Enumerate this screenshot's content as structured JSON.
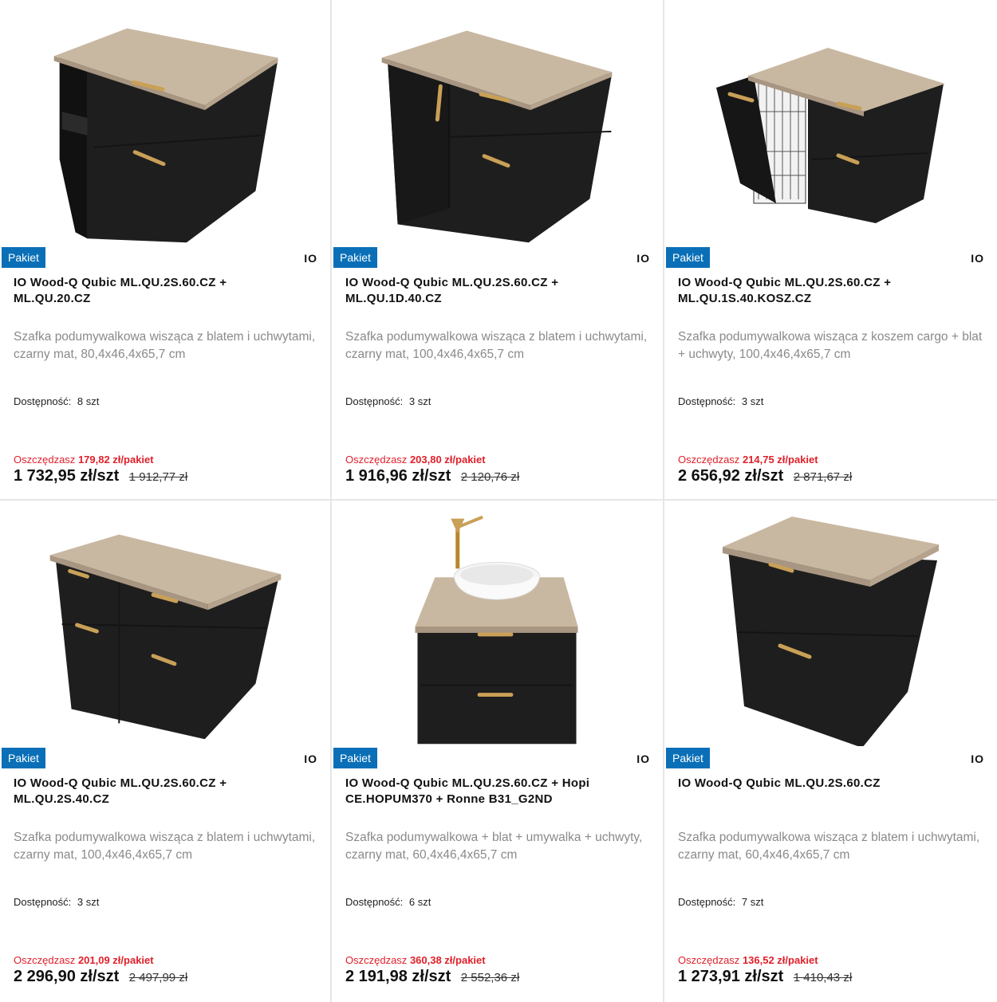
{
  "colors": {
    "badge": "#0a6fb7",
    "saving": "#e0202a",
    "cabinet": "#1f1f1f",
    "wood": "#c8b8a2",
    "handle": "#c9a057"
  },
  "products": [
    {
      "badge": "Pakiet",
      "brand": "IO",
      "title": "IO Wood-Q Qubic ML.QU.2S.60.CZ + ML.QU.20.CZ",
      "description": "Szafka podumywalkowa wisząca z blatem i uchwytami, czarny mat, 80,4x46,4x65,7 cm",
      "availability_label": "Dostępność:",
      "availability_value": "8 szt",
      "saving_label": "Oszczędzasz",
      "saving_amount": "179,82 zł/pakiet",
      "price": "1 732,95 zł/szt",
      "old_price": "1 912,77 zł",
      "image_icon": "open-shelf-cabinet-icon"
    },
    {
      "badge": "Pakiet",
      "brand": "IO",
      "title": "IO Wood-Q Qubic ML.QU.2S.60.CZ + ML.QU.1D.40.CZ",
      "description": "Szafka podumywalkowa wisząca z blatem i uchwytami, czarny mat, 100,4x46,4x65,7 cm",
      "availability_label": "Dostępność:",
      "availability_value": "3 szt",
      "saving_label": "Oszczędzasz",
      "saving_amount": "203,80 zł/pakiet",
      "price": "1 916,96 zł/szt",
      "old_price": "2 120,76 zł",
      "image_icon": "door-drawer-cabinet-icon"
    },
    {
      "badge": "Pakiet",
      "brand": "IO",
      "title": "IO Wood-Q Qubic ML.QU.2S.60.CZ + ML.QU.1S.40.KOSZ.CZ",
      "description": "Szafka podumywalkowa wisząca z koszem cargo + blat + uchwyty, 100,4x46,4x65,7 cm",
      "availability_label": "Dostępność:",
      "availability_value": "3 szt",
      "saving_label": "Oszczędzasz",
      "saving_amount": "214,75 zł/pakiet",
      "price": "2 656,92 zł/szt",
      "old_price": "2 871,67 zł",
      "image_icon": "cargo-basket-cabinet-icon"
    },
    {
      "badge": "Pakiet",
      "brand": "IO",
      "title": "IO Wood-Q Qubic ML.QU.2S.60.CZ + ML.QU.2S.40.CZ",
      "description": "Szafka podumywalkowa wisząca z blatem i uchwytami, czarny mat, 100,4x46,4x65,7 cm",
      "availability_label": "Dostępność:",
      "availability_value": "3 szt",
      "saving_label": "Oszczędzasz",
      "saving_amount": "201,09 zł/pakiet",
      "price": "2 296,90 zł/szt",
      "old_price": "2 497,99 zł",
      "image_icon": "four-drawer-cabinet-icon"
    },
    {
      "badge": "Pakiet",
      "brand": "IO",
      "title": "IO Wood-Q Qubic ML.QU.2S.60.CZ + Hopi CE.HOPUM370 + Ronne B31_G2ND",
      "description": "Szafka podumywalkowa + blat + umywalka + uchwyty, czarny mat, 60,4x46,4x65,7 cm",
      "availability_label": "Dostępność:",
      "availability_value": "6 szt",
      "saving_label": "Oszczędzasz",
      "saving_amount": "360,38 zł/pakiet",
      "price": "2 191,98 zł/szt",
      "old_price": "2 552,36 zł",
      "image_icon": "vanity-with-basin-icon"
    },
    {
      "badge": "Pakiet",
      "brand": "IO",
      "title": "IO Wood-Q Qubic ML.QU.2S.60.CZ",
      "description": "Szafka podumywalkowa wisząca z blatem i uchwytami, czarny mat, 60,4x46,4x65,7 cm",
      "availability_label": "Dostępność:",
      "availability_value": "7 szt",
      "saving_label": "Oszczędzasz",
      "saving_amount": "136,52 zł/pakiet",
      "price": "1 273,91 zł/szt",
      "old_price": "1 410,43 zł",
      "image_icon": "two-drawer-cabinet-icon"
    }
  ]
}
